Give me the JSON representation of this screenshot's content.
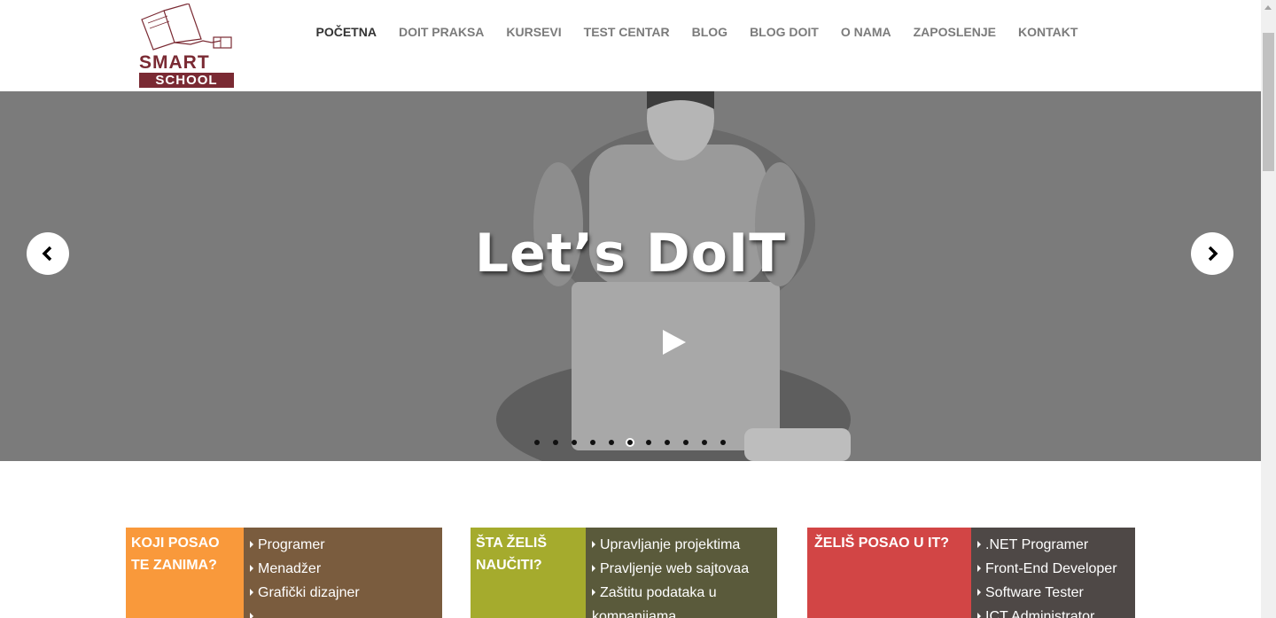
{
  "logo": {
    "line1": "SMART",
    "line2": "SCHOOL"
  },
  "nav": {
    "items": [
      {
        "label": "POČETNA",
        "active": true
      },
      {
        "label": "DOIT PRAKSA",
        "active": false
      },
      {
        "label": "KURSEVI",
        "active": false
      },
      {
        "label": "TEST CENTAR",
        "active": false
      },
      {
        "label": "BLOG",
        "active": false
      },
      {
        "label": "BLOG DOIT",
        "active": false
      },
      {
        "label": "O NAMA",
        "active": false
      },
      {
        "label": "ZAPOSLENJE",
        "active": false
      },
      {
        "label": "KONTAKT",
        "active": false
      }
    ]
  },
  "hero": {
    "title": "Let’s DoIT",
    "prev_icon": "chevron-left-icon",
    "next_icon": "chevron-right-icon",
    "play_icon": "play-icon",
    "slide_count": 11,
    "active_slide": 6
  },
  "boxes": [
    {
      "title_line1": "KOJI POSAO",
      "title_line2": "TE ZANIMA?",
      "title_color": "#f9993b",
      "list_color": "#7a5c3e",
      "items": [
        "Programer",
        "Menadžer",
        "Grafički dizajner",
        "......."
      ]
    },
    {
      "title_line1": "ŠTA ŽELIŠ",
      "title_line2": "NAUČITI?",
      "title_color": "#a5ab2d",
      "list_color": "#5a5a3b",
      "items": [
        "Upravljanje projektima",
        "Pravljenje web sajtovaa",
        "Zaštitu podataka u",
        "kompanijama"
      ]
    },
    {
      "title_line1": "ŽELIŠ POSAO U IT?",
      "title_line2": "",
      "title_color": "#d24545",
      "list_color": "#4e4846",
      "items": [
        ".NET Programer",
        "Front-End Developer",
        "Software Tester",
        "ICT Administrator"
      ]
    }
  ]
}
